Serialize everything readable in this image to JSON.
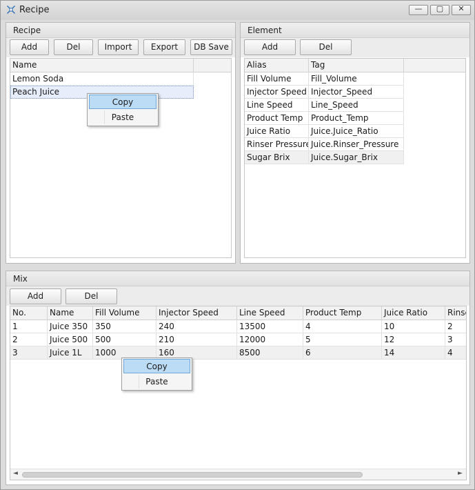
{
  "window": {
    "title": "Recipe",
    "min_glyph": "—",
    "max_glyph": "▢",
    "close_glyph": "✕"
  },
  "recipe": {
    "title": "Recipe",
    "buttons": {
      "add": "Add",
      "del": "Del",
      "import": "Import",
      "export": "Export",
      "db_save": "DB Save"
    },
    "column_name": "Name",
    "rows": [
      "Lemon Soda",
      "Peach Juice"
    ]
  },
  "element": {
    "title": "Element",
    "buttons": {
      "add": "Add",
      "del": "Del"
    },
    "columns": [
      "Alias",
      "Tag"
    ],
    "rows": [
      [
        "Fill Volume",
        "Fill_Volume"
      ],
      [
        "Injector Speed",
        "Injector_Speed"
      ],
      [
        "Line Speed",
        "Line_Speed"
      ],
      [
        "Product Temp",
        "Product_Temp"
      ],
      [
        "Juice Ratio",
        "Juice.Juice_Ratio"
      ],
      [
        "Rinser Pressure",
        "Juice.Rinser_Pressure"
      ],
      [
        "Sugar Brix",
        "Juice.Sugar_Brix"
      ]
    ]
  },
  "mix": {
    "title": "Mix",
    "buttons": {
      "add": "Add",
      "del": "Del"
    },
    "columns": [
      "No.",
      "Name",
      "Fill Volume",
      "Injector Speed",
      "Line Speed",
      "Product Temp",
      "Juice Ratio",
      "Rinse"
    ],
    "rows": [
      [
        "1",
        "Juice 350",
        "350",
        "240",
        "13500",
        "4",
        "10",
        "2"
      ],
      [
        "2",
        "Juice 500",
        "500",
        "210",
        "12000",
        "5",
        "12",
        "3"
      ],
      [
        "3",
        "Juice 1L",
        "1000",
        "160",
        "8500",
        "6",
        "14",
        "4"
      ]
    ],
    "scroll_left_glyph": "◄",
    "scroll_right_glyph": "►"
  },
  "context_menu": {
    "copy": "Copy",
    "paste": "Paste"
  },
  "colors": {
    "menu_highlight": "#bcdcf6",
    "selected_row": "#e6eefb"
  }
}
